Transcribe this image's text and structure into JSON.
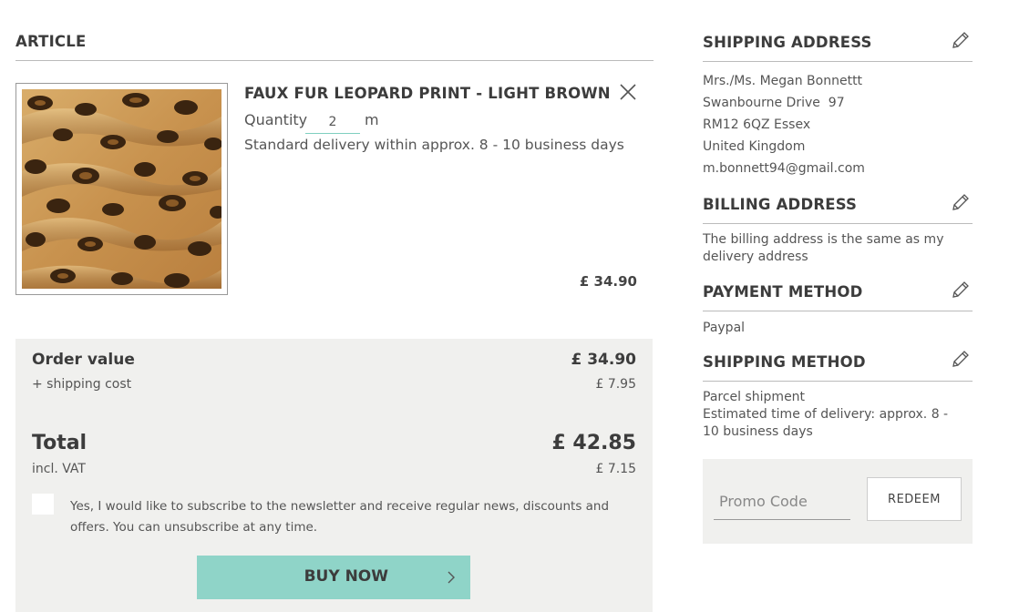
{
  "article": {
    "heading": "ARTICLE",
    "product_name": "FAUX FUR LEOPARD PRINT - LIGHT BROWN",
    "quantity_label": "Quantity",
    "quantity_value": "2",
    "quantity_unit": "m",
    "delivery_note": "Standard delivery within approx. 8 - 10 business days",
    "price": "£ 34.90",
    "remove_icon": "close-icon",
    "image": "leopard-fur-fabric-image"
  },
  "summary": {
    "order_value_label": "Order value",
    "order_value": "£ 34.90",
    "shipping_label": "+ shipping cost",
    "shipping_value": "£ 7.95",
    "total_label": "Total",
    "total_value": "£ 42.85",
    "vat_label": "incl. VAT",
    "vat_value": "£ 7.15",
    "newsletter_text": "Yes, I would like to subscribe to the newsletter and receive regular news, discounts and offers. You can unsubscribe at any time.",
    "newsletter_checked": false,
    "buy_now_label": "BUY NOW",
    "buy_now_icon": "chevron-right-icon",
    "button_color": "#8fd4c8",
    "box_color": "#f0f0ee"
  },
  "sidebar": {
    "shipping_address": {
      "heading": "SHIPPING ADDRESS",
      "lines": [
        "Mrs./Ms. Megan Bonnettt",
        "Swanbourne Drive  97",
        "RM12 6QZ Essex",
        "United Kingdom",
        "m.bonnett94@gmail.com"
      ],
      "edit_icon": "pencil-icon"
    },
    "billing_address": {
      "heading": "BILLING ADDRESS",
      "text": "The billing address is the same as my delivery address",
      "edit_icon": "pencil-icon"
    },
    "payment_method": {
      "heading": "PAYMENT METHOD",
      "text": "Paypal",
      "edit_icon": "pencil-icon"
    },
    "shipping_method": {
      "heading": "SHIPPING METHOD",
      "text": "Parcel shipment\nEstimated time of delivery: approx. 8 - 10 business days",
      "line1": "Parcel shipment",
      "line2": "Estimated time of delivery: approx. 8 - 10 business days",
      "edit_icon": "pencil-icon"
    },
    "promo": {
      "placeholder": "Promo Code",
      "redeem_label": "REDEEM"
    }
  }
}
